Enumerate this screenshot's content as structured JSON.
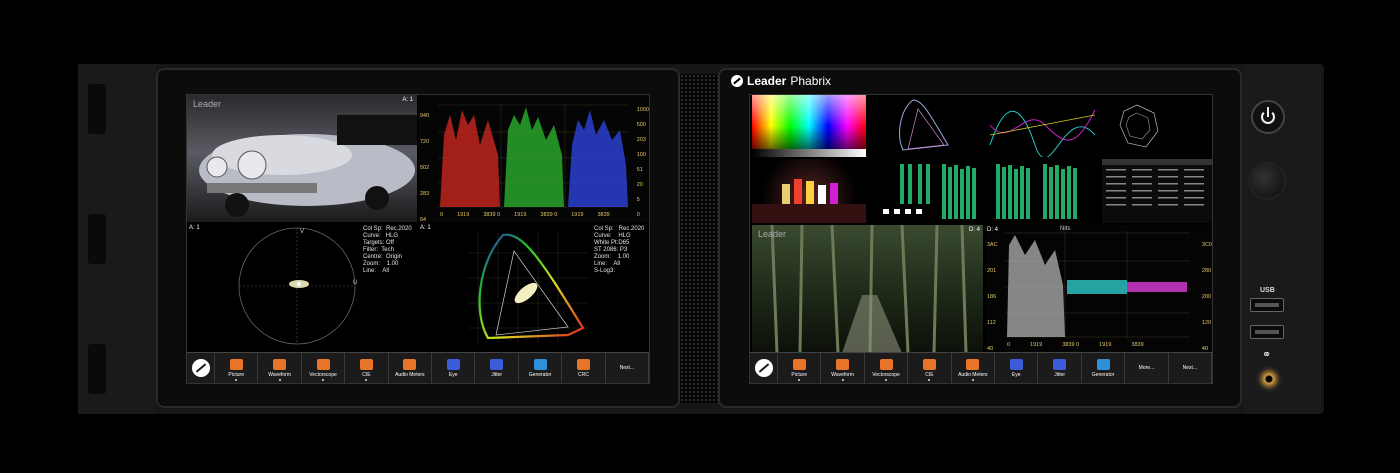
{
  "left_screen": {
    "picture": {
      "tag": "A: 1",
      "watermark": "Leader"
    },
    "waveform": {
      "left_ticks": [
        "940",
        "720",
        "502",
        "283",
        "64"
      ],
      "right_ticks": [
        "1000",
        "500",
        "203",
        "100",
        "51",
        "20",
        "5",
        "0"
      ],
      "x_ticks": [
        "0",
        "1919",
        "3839 0",
        "1919",
        "3839 0",
        "1919",
        "3839"
      ]
    },
    "vectorscope": {
      "tag": "A: 1",
      "info": "Col Sp:  Rec.2020\nCurve:   HLG\nTargets: Off\nFilter:  Tech\nCentre:  Origin\nZoom:    1.00\nLine:    All",
      "axis_v": "V",
      "axis_u": "U"
    },
    "cie": {
      "tag": "A: 1",
      "info": "Col Sp:   Rec.2020\nCurve:    HLG\nWhite Pt:D65\nST 2086: P3\nZoom:    1.00\nLine:    All\nS-Log3:"
    },
    "toolbar": [
      {
        "label": "Picture",
        "color": "#e8742a",
        "dot": true
      },
      {
        "label": "Waveform",
        "color": "#e8742a",
        "dot": true
      },
      {
        "label": "Vectorscope",
        "color": "#e8742a",
        "dot": true
      },
      {
        "label": "CIE",
        "color": "#e8742a",
        "dot": true
      },
      {
        "label": "Audio Meters",
        "color": "#e8742a",
        "dot": false
      },
      {
        "label": "Eye",
        "color": "#3b5bd9",
        "dot": false
      },
      {
        "label": "Jitter",
        "color": "#3b5bd9",
        "dot": false
      },
      {
        "label": "Generator",
        "color": "#2f8fd8",
        "dot": false
      },
      {
        "label": "CRC",
        "color": "#e8742a",
        "dot": false
      },
      {
        "label": "Next...",
        "color": "",
        "dot": false
      }
    ]
  },
  "right_screen": {
    "brand": {
      "part1": "Leader",
      "part2": "Phabrix"
    },
    "waveform": {
      "tag": "D: 4",
      "unit": "Nits",
      "left_ticks": [
        "3AC",
        "201",
        "186",
        "112",
        "40"
      ],
      "right_ticks": [
        "3C0",
        "280",
        "200",
        "120",
        "40"
      ],
      "x_ticks": [
        "0",
        "1919",
        "3839 0",
        "1919",
        "3839"
      ]
    },
    "picture": {
      "tag": "D: 4",
      "watermark": "Leader"
    },
    "toolbar": [
      {
        "label": "Picture",
        "color": "#e8742a",
        "dot": true
      },
      {
        "label": "Waveform",
        "color": "#e8742a",
        "dot": true
      },
      {
        "label": "Vectorscope",
        "color": "#e8742a",
        "dot": true
      },
      {
        "label": "CIE",
        "color": "#e8742a",
        "dot": true
      },
      {
        "label": "Audio Meters",
        "color": "#e8742a",
        "dot": true
      },
      {
        "label": "Eye",
        "color": "#3b5bd9",
        "dot": false
      },
      {
        "label": "Jitter",
        "color": "#3b5bd9",
        "dot": false
      },
      {
        "label": "Generator",
        "color": "#2f8fd8",
        "dot": false
      },
      {
        "label": "More...",
        "color": "",
        "dot": false
      },
      {
        "label": "Next...",
        "color": "",
        "dot": false
      }
    ]
  },
  "front_panel": {
    "usb_label": "USB"
  },
  "colors": {
    "accent_orange": "#e8742a",
    "accent_blue": "#3b5bd9",
    "gold": "#e6c96b"
  }
}
